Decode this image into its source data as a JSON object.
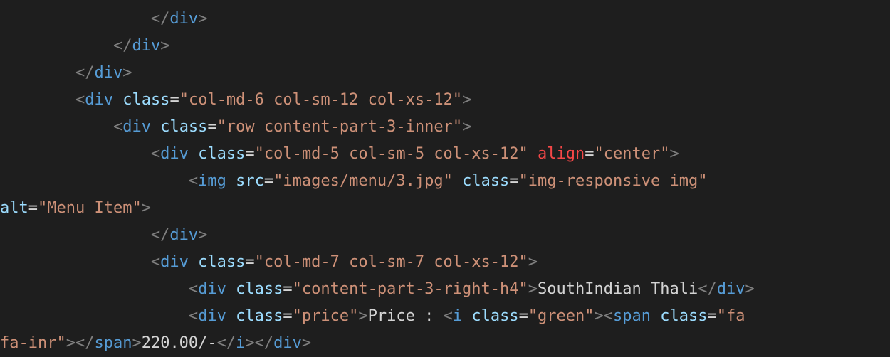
{
  "editor": {
    "colors": {
      "background": "#1e1e1e",
      "punctuation": "#808080",
      "tag": "#569cd6",
      "attribute": "#9cdcfe",
      "attribute_warning": "#f44747",
      "string": "#ce9178",
      "text": "#d4d4d4"
    },
    "lines": [
      [
        {
          "t": "                "
        },
        {
          "t": "</",
          "c": "punct"
        },
        {
          "t": "div",
          "c": "tag"
        },
        {
          "t": ">",
          "c": "punct"
        }
      ],
      [
        {
          "t": "            "
        },
        {
          "t": "</",
          "c": "punct"
        },
        {
          "t": "div",
          "c": "tag"
        },
        {
          "t": ">",
          "c": "punct"
        }
      ],
      [
        {
          "t": "        "
        },
        {
          "t": "</",
          "c": "punct"
        },
        {
          "t": "div",
          "c": "tag"
        },
        {
          "t": ">",
          "c": "punct"
        }
      ],
      [
        {
          "t": "        "
        },
        {
          "t": "<",
          "c": "punct"
        },
        {
          "t": "div",
          "c": "tag"
        },
        {
          "t": " "
        },
        {
          "t": "class",
          "c": "attr"
        },
        {
          "t": "=",
          "c": "eq"
        },
        {
          "t": "\"col-md-6 col-sm-12 col-xs-12\"",
          "c": "str"
        },
        {
          "t": ">",
          "c": "punct"
        }
      ],
      [
        {
          "t": "            "
        },
        {
          "t": "<",
          "c": "punct"
        },
        {
          "t": "div",
          "c": "tag"
        },
        {
          "t": " "
        },
        {
          "t": "class",
          "c": "attr"
        },
        {
          "t": "=",
          "c": "eq"
        },
        {
          "t": "\"row content-part-3-inner\"",
          "c": "str"
        },
        {
          "t": ">",
          "c": "punct"
        }
      ],
      [
        {
          "t": "                "
        },
        {
          "t": "<",
          "c": "punct"
        },
        {
          "t": "div",
          "c": "tag"
        },
        {
          "t": " "
        },
        {
          "t": "class",
          "c": "attr"
        },
        {
          "t": "=",
          "c": "eq"
        },
        {
          "t": "\"col-md-5 col-sm-5 col-xs-12\"",
          "c": "str"
        },
        {
          "t": " "
        },
        {
          "t": "align",
          "c": "attr-warn"
        },
        {
          "t": "=",
          "c": "eq"
        },
        {
          "t": "\"center\"",
          "c": "str"
        },
        {
          "t": ">",
          "c": "punct"
        }
      ],
      [
        {
          "t": "                    "
        },
        {
          "t": "<",
          "c": "punct"
        },
        {
          "t": "img",
          "c": "tag"
        },
        {
          "t": " "
        },
        {
          "t": "src",
          "c": "attr"
        },
        {
          "t": "=",
          "c": "eq"
        },
        {
          "t": "\"images/menu/3.jpg\"",
          "c": "str"
        },
        {
          "t": " "
        },
        {
          "t": "class",
          "c": "attr"
        },
        {
          "t": "=",
          "c": "eq"
        },
        {
          "t": "\"img-responsive img\"",
          "c": "str"
        }
      ],
      [
        {
          "t": "alt",
          "c": "attr"
        },
        {
          "t": "=",
          "c": "eq"
        },
        {
          "t": "\"Menu Item\"",
          "c": "str"
        },
        {
          "t": ">",
          "c": "punct"
        }
      ],
      [
        {
          "t": "                "
        },
        {
          "t": "</",
          "c": "punct"
        },
        {
          "t": "div",
          "c": "tag"
        },
        {
          "t": ">",
          "c": "punct"
        }
      ],
      [
        {
          "t": "                "
        },
        {
          "t": "<",
          "c": "punct"
        },
        {
          "t": "div",
          "c": "tag"
        },
        {
          "t": " "
        },
        {
          "t": "class",
          "c": "attr"
        },
        {
          "t": "=",
          "c": "eq"
        },
        {
          "t": "\"col-md-7 col-sm-7 col-xs-12\"",
          "c": "str"
        },
        {
          "t": ">",
          "c": "punct"
        }
      ],
      [
        {
          "t": "                    "
        },
        {
          "t": "<",
          "c": "punct"
        },
        {
          "t": "div",
          "c": "tag"
        },
        {
          "t": " "
        },
        {
          "t": "class",
          "c": "attr"
        },
        {
          "t": "=",
          "c": "eq"
        },
        {
          "t": "\"content-part-3-right-h4\"",
          "c": "str"
        },
        {
          "t": ">",
          "c": "punct"
        },
        {
          "t": "SouthIndian Thali",
          "c": "text"
        },
        {
          "t": "</",
          "c": "punct"
        },
        {
          "t": "div",
          "c": "tag"
        },
        {
          "t": ">",
          "c": "punct"
        }
      ],
      [
        {
          "t": "                    "
        },
        {
          "t": "<",
          "c": "punct"
        },
        {
          "t": "div",
          "c": "tag"
        },
        {
          "t": " "
        },
        {
          "t": "class",
          "c": "attr"
        },
        {
          "t": "=",
          "c": "eq"
        },
        {
          "t": "\"price\"",
          "c": "str"
        },
        {
          "t": ">",
          "c": "punct"
        },
        {
          "t": "Price : ",
          "c": "text"
        },
        {
          "t": "<",
          "c": "punct"
        },
        {
          "t": "i",
          "c": "tag"
        },
        {
          "t": " "
        },
        {
          "t": "class",
          "c": "attr"
        },
        {
          "t": "=",
          "c": "eq"
        },
        {
          "t": "\"green\"",
          "c": "str"
        },
        {
          "t": ">",
          "c": "punct"
        },
        {
          "t": "<",
          "c": "punct"
        },
        {
          "t": "span",
          "c": "tag"
        },
        {
          "t": " "
        },
        {
          "t": "class",
          "c": "attr"
        },
        {
          "t": "=",
          "c": "eq"
        },
        {
          "t": "\"fa",
          "c": "str"
        }
      ],
      [
        {
          "t": "fa-inr\"",
          "c": "str"
        },
        {
          "t": ">",
          "c": "punct"
        },
        {
          "t": "</",
          "c": "punct"
        },
        {
          "t": "span",
          "c": "tag"
        },
        {
          "t": ">",
          "c": "punct"
        },
        {
          "t": "220.00/-",
          "c": "text"
        },
        {
          "t": "</",
          "c": "punct"
        },
        {
          "t": "i",
          "c": "tag"
        },
        {
          "t": ">",
          "c": "punct"
        },
        {
          "t": "</",
          "c": "punct"
        },
        {
          "t": "div",
          "c": "tag"
        },
        {
          "t": ">",
          "c": "punct"
        }
      ]
    ]
  }
}
